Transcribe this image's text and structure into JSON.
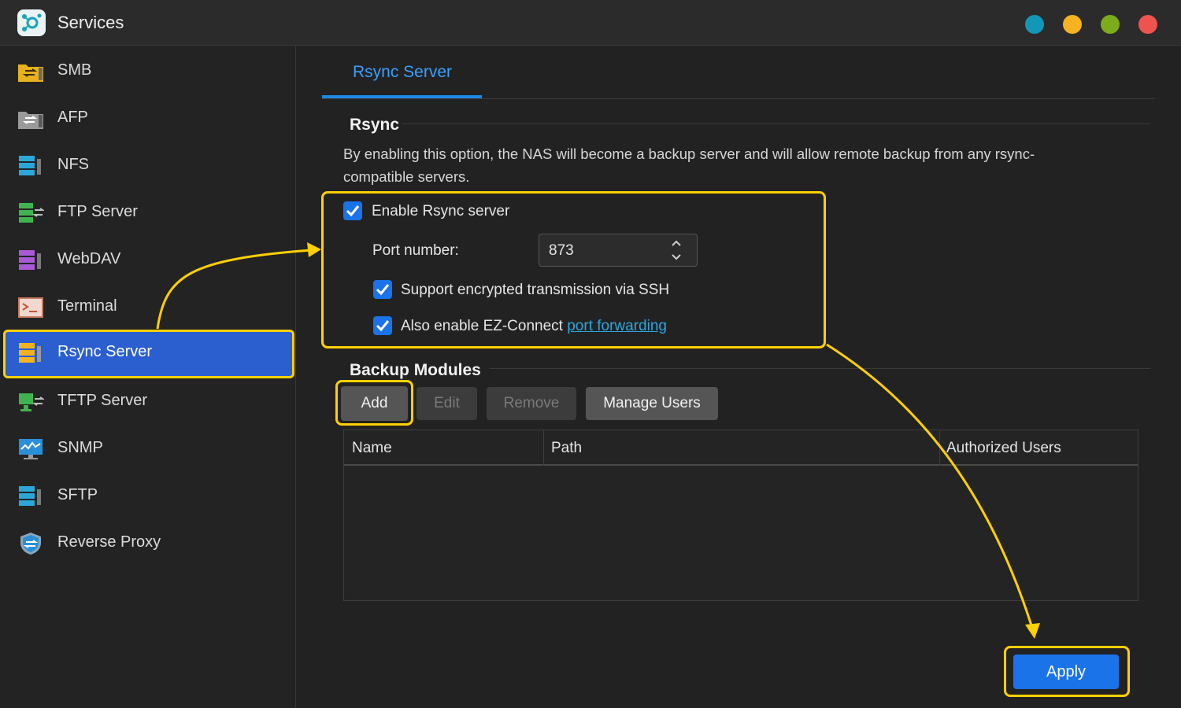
{
  "window": {
    "title": "Services",
    "dots": [
      "#1297b8",
      "#f5b320",
      "#7cab1c",
      "#ef5350"
    ]
  },
  "sidebar": {
    "items": [
      {
        "label": "SMB",
        "icon": "smb-folder-icon",
        "active": false
      },
      {
        "label": "AFP",
        "icon": "afp-folder-icon",
        "active": false
      },
      {
        "label": "NFS",
        "icon": "nfs-server-icon",
        "active": false
      },
      {
        "label": "FTP Server",
        "icon": "ftp-server-icon",
        "active": false
      },
      {
        "label": "WebDAV",
        "icon": "webdav-server-icon",
        "active": false
      },
      {
        "label": "Terminal",
        "icon": "terminal-icon",
        "active": false
      },
      {
        "label": "Rsync Server",
        "icon": "rsync-server-icon",
        "active": true
      },
      {
        "label": "TFTP Server",
        "icon": "tftp-server-icon",
        "active": false
      },
      {
        "label": "SNMP",
        "icon": "snmp-monitor-icon",
        "active": false
      },
      {
        "label": "SFTP",
        "icon": "sftp-server-icon",
        "active": false
      },
      {
        "label": "Reverse Proxy",
        "icon": "reverse-proxy-shield-icon",
        "active": false
      }
    ]
  },
  "main": {
    "tab": "Rsync Server",
    "rsync": {
      "title": "Rsync",
      "description": "By enabling this option, the NAS will become a backup server and will allow remote backup from any rsync-compatible servers.",
      "enable_label": "Enable Rsync server",
      "enable_checked": true,
      "port_label": "Port number:",
      "port_value": "873",
      "ssh_label": "Support encrypted transmission via SSH",
      "ssh_checked": true,
      "ez_label": "Also enable EZ-Connect",
      "ez_link": "port forwarding",
      "ez_checked": true
    },
    "backup": {
      "title": "Backup Modules",
      "buttons": {
        "add": "Add",
        "edit": "Edit",
        "remove": "Remove",
        "manage_users": "Manage Users"
      },
      "columns": [
        "Name",
        "Path",
        "Authorized Users"
      ],
      "rows": []
    },
    "apply_label": "Apply"
  },
  "colors": {
    "accent": "#1a73e8",
    "highlight": "#ffd000",
    "active_nav": "#2b5fd0"
  }
}
